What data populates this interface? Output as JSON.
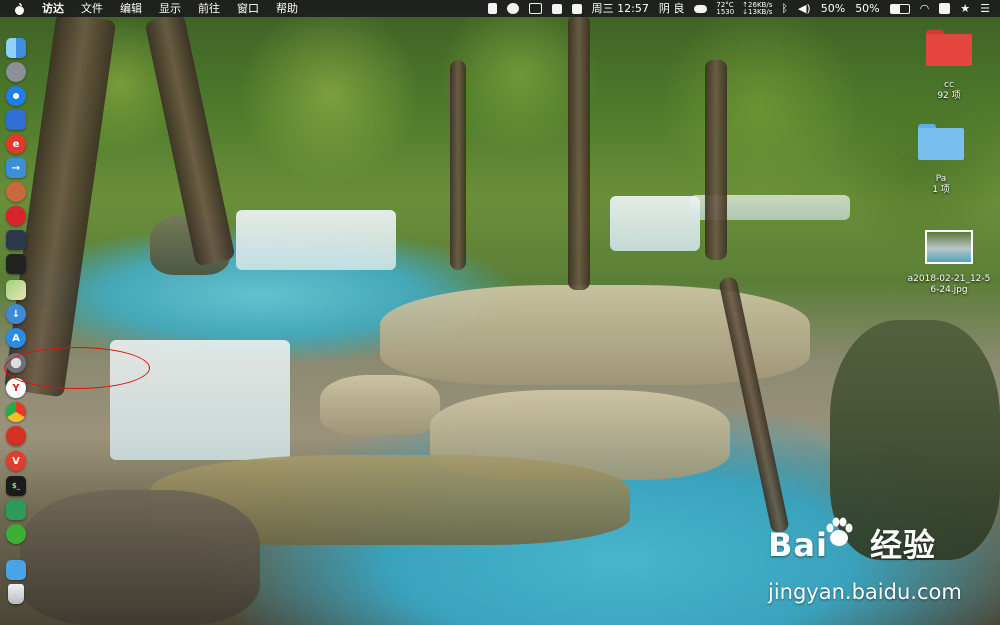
{
  "menubar": {
    "app_name": "访达",
    "menus": [
      "文件",
      "编辑",
      "显示",
      "前往",
      "窗口",
      "帮助"
    ],
    "status": {
      "day_time": "周三 12:57",
      "weather": "阴 良",
      "temp": "72°C",
      "cpu": "1530",
      "net_up": "↑26KB/s",
      "net_down": "↓13KB/s",
      "battery1": "50%",
      "battery2": "50%"
    }
  },
  "dock": {
    "items": [
      {
        "icon": "finder-icon",
        "color": "#4a9be8",
        "glyph": ""
      },
      {
        "icon": "launchpad-icon",
        "color": "#8a8f98",
        "glyph": ""
      },
      {
        "icon": "safari-icon",
        "color": "#1e7de6",
        "glyph": ""
      },
      {
        "icon": "search-app-icon",
        "color": "#2f6fd6",
        "glyph": ""
      },
      {
        "icon": "e-app-icon",
        "color": "#e23a2a",
        "glyph": ""
      },
      {
        "icon": "migration-icon",
        "color": "#3a8fd8",
        "glyph": ""
      },
      {
        "icon": "fox-icon",
        "color": "#c86a3e",
        "glyph": ""
      },
      {
        "icon": "mark-app-icon",
        "color": "#d8242a",
        "glyph": ""
      },
      {
        "icon": "screen-app-icon",
        "color": "#2a3a4a",
        "glyph": ""
      },
      {
        "icon": "dark-app-icon",
        "color": "#222222",
        "glyph": ""
      },
      {
        "icon": "maps-icon",
        "color": "#7fb85c",
        "glyph": ""
      },
      {
        "icon": "download-icon",
        "color": "#3f8ad6",
        "glyph": ""
      },
      {
        "icon": "appstore-icon",
        "color": "#2a8ce6",
        "glyph": ""
      },
      {
        "icon": "system-preferences-icon",
        "color": "#6e7178",
        "glyph": ""
      },
      {
        "icon": "yandex-icon",
        "color": "#e4201f",
        "glyph": ""
      },
      {
        "icon": "chrome-icon",
        "color": "#e9b02a",
        "glyph": ""
      },
      {
        "icon": "netease-music-icon",
        "color": "#d23124",
        "glyph": ""
      },
      {
        "icon": "vivaldi-icon",
        "color": "#e23b2f",
        "glyph": ""
      },
      {
        "icon": "terminal-icon",
        "color": "#1b1b1b",
        "glyph": ""
      },
      {
        "icon": "green-app-icon",
        "color": "#2e9a5a",
        "glyph": ""
      },
      {
        "icon": "wechat-icon",
        "color": "#3cb034",
        "glyph": ""
      },
      {
        "icon": "folder-stack-icon",
        "color": "#4aa3e6",
        "glyph": ""
      },
      {
        "icon": "trash-icon",
        "color": "#c9ccd1",
        "glyph": ""
      }
    ]
  },
  "desktop": {
    "items": [
      {
        "name": "cc",
        "detail": "92 项",
        "type": "folder",
        "color": "#e4463f"
      },
      {
        "name": "Pa",
        "detail": "1 项",
        "type": "folder",
        "color": "#79bff0"
      },
      {
        "name": "a2018-02-21_12-56-24.jpg",
        "line1": "a2018-02-21_12-5",
        "line2": "6-24.jpg",
        "type": "image"
      }
    ]
  },
  "watermark": {
    "logo_text": "Bai",
    "logo_text2": "经验",
    "url": "jingyan.baidu.com"
  }
}
